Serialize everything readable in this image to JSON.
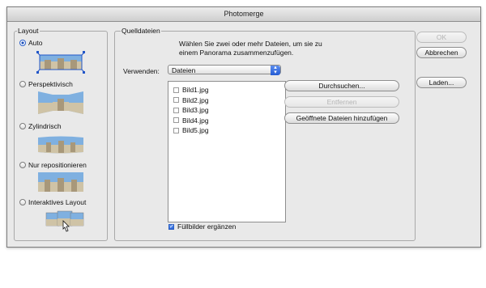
{
  "window": {
    "title": "Photomerge"
  },
  "layout_group": {
    "title": "Layout",
    "options": [
      {
        "label": "Auto",
        "checked": true
      },
      {
        "label": "Perspektivisch",
        "checked": false
      },
      {
        "label": "Zylindrisch",
        "checked": false
      },
      {
        "label": "Nur repositionieren",
        "checked": false
      },
      {
        "label": "Interaktives Layout",
        "checked": false
      }
    ]
  },
  "source_group": {
    "title": "Quelldateien",
    "instructions_line1": "Wählen Sie zwei oder mehr Dateien, um sie zu",
    "instructions_line2": "einem Panorama zusammenzufügen.",
    "use_label": "Verwenden:",
    "use_value": "Dateien",
    "files": [
      "Bild1.jpg",
      "Bild2.jpg",
      "Bild3.jpg",
      "Bild4.jpg",
      "Bild5.jpg"
    ],
    "browse_label": "Durchsuchen...",
    "remove_label": "Entfernen",
    "add_open_label": "Geöffnete Dateien hinzufügen",
    "fill_label": "Füllbilder ergänzen",
    "fill_checked": true
  },
  "actions": {
    "ok_label": "OK",
    "cancel_label": "Abbrechen",
    "load_label": "Laden..."
  },
  "colors": {
    "accent_blue": "#245bd3",
    "window_bg": "#e9e9e9",
    "sky": "#7fb0e0",
    "building": "#cfc3a6"
  }
}
